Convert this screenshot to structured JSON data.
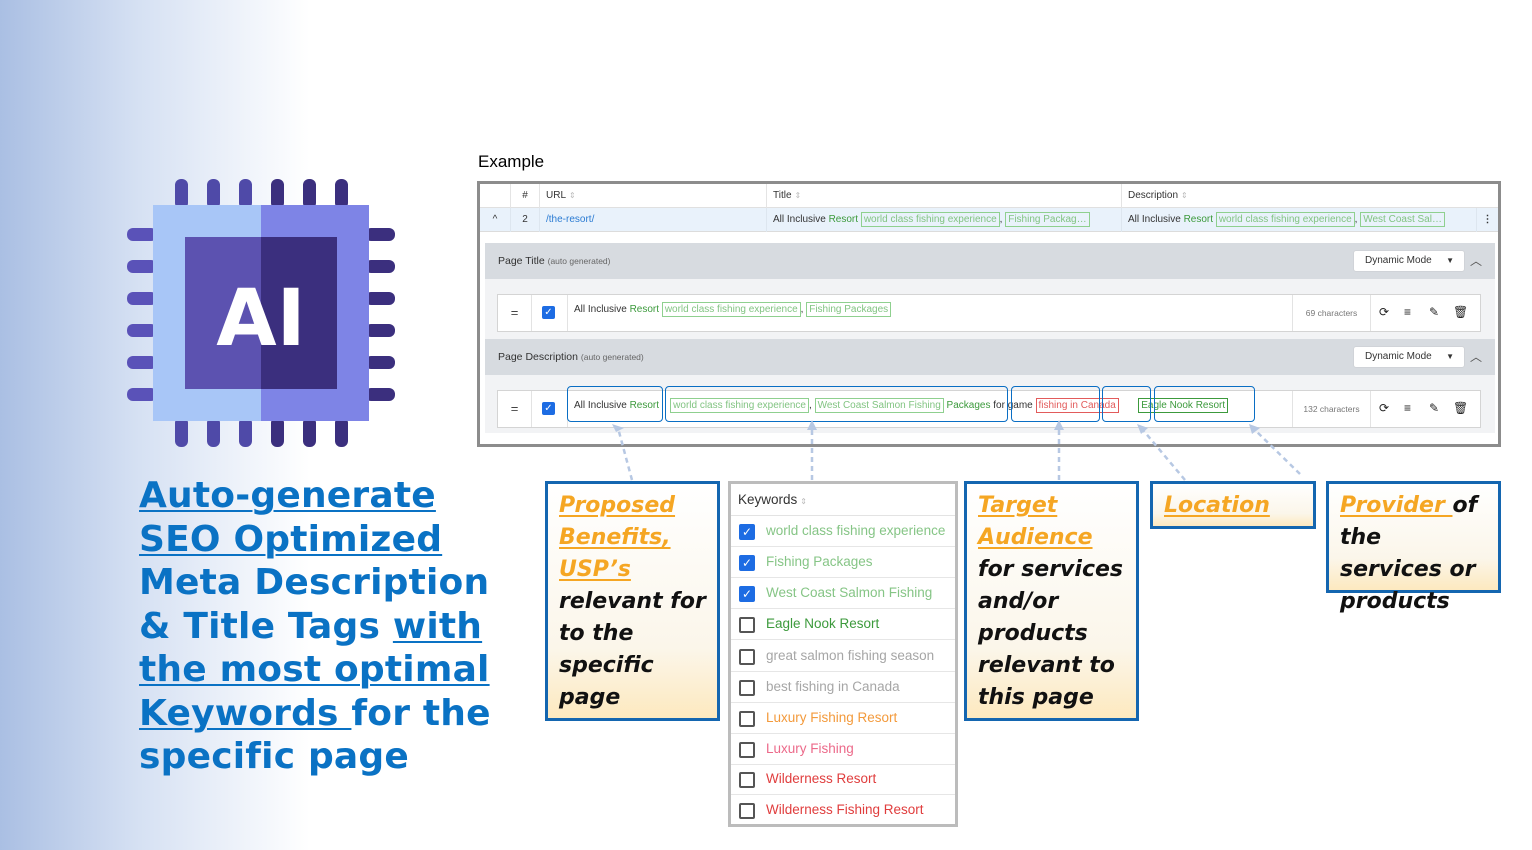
{
  "headline": {
    "part1": "Auto-generate SEO Optimized",
    "part2": " Meta Description & Title Tags ",
    "part3": "with the most optimal Keywords ",
    "part4": "for the specific page"
  },
  "chip_logo_text": "AI",
  "example": {
    "label": "Example",
    "columns": {
      "num": "#",
      "url": "URL",
      "title": "Title",
      "description": "Description"
    },
    "row": {
      "toggle": "^",
      "num": "2",
      "url": "/the-resort/",
      "title_plain": "All Inclusive ",
      "title_resort": "Resort",
      "title_chip1": "world class fishing experience",
      "title_sep": ",",
      "title_chip2": "Fishing Packag…",
      "desc_plain": "All Inclusive ",
      "desc_resort": "Resort",
      "desc_chip1": "world class fishing experience",
      "desc_sep": ",",
      "desc_chip2": "West Coast Sal…",
      "menu": "⋮"
    },
    "page_title": {
      "label": "Page Title",
      "hint": "(auto generated)",
      "mode": "Dynamic Mode",
      "text_plain": "All Inclusive ",
      "text_resort": "Resort",
      "chip1": "world class fishing experience",
      "sep": ",",
      "chip2": "Fishing Packages",
      "count": "69 characters"
    },
    "page_description": {
      "label": "Page Description",
      "hint": "(auto generated)",
      "mode": "Dynamic Mode",
      "text_plain": "All Inclusive ",
      "text_resort": "Resort",
      "chip1": "world class fishing experience",
      "sep": ",",
      "chip2": "West Coast Salmon Fishing",
      "packages": "Packages",
      "for_game": " for game ",
      "chip_location": "fishing in Canada",
      "chip_provider": "Eagle Nook Resort",
      "count": "132 characters"
    }
  },
  "keywords": {
    "header": "Keywords",
    "items": [
      {
        "label": "world class fishing experience",
        "checked": true,
        "color": "#86c586"
      },
      {
        "label": "Fishing Packages",
        "checked": true,
        "color": "#86c586"
      },
      {
        "label": "West Coast Salmon Fishing",
        "checked": true,
        "color": "#86c586"
      },
      {
        "label": "Eagle Nook Resort",
        "checked": false,
        "color": "#3c9a3c"
      },
      {
        "label": "great salmon fishing season",
        "checked": false,
        "color": "#a6a6a6"
      },
      {
        "label": "best fishing in Canada",
        "checked": false,
        "color": "#a6a6a6"
      },
      {
        "label": "Luxury Fishing Resort",
        "checked": false,
        "color": "#f39a3c"
      },
      {
        "label": "Luxury Fishing",
        "checked": false,
        "color": "#ec6a8a"
      },
      {
        "label": "Wilderness Resort",
        "checked": false,
        "color": "#e03d3d"
      },
      {
        "label": "Wilderness Fishing Resort",
        "checked": false,
        "color": "#e03d3d"
      }
    ]
  },
  "callouts": {
    "benefits_highlight": "Proposed Benefits, USP’s",
    "benefits_rest": " relevant for to the specific page",
    "audience_highlight": "Target Audience ",
    "audience_rest": "for services and/or products relevant to this page",
    "location_highlight": "Location",
    "provider_highlight": "Provider ",
    "provider_rest": "of the services or products"
  },
  "colors": {
    "headline_blue": "#0a72c4",
    "callout_border": "#1466b0",
    "highlight_orange": "#f5a623",
    "chip_purple_dark": "#3b2f7e",
    "chip_purple_light": "#6f67d6"
  }
}
